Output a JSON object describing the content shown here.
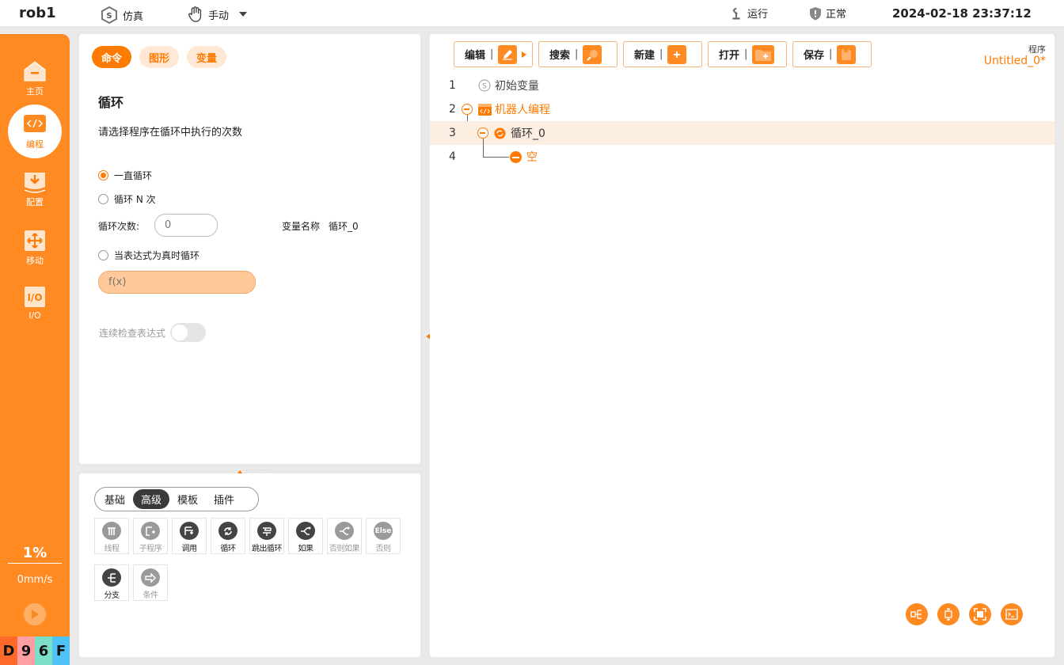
{
  "topbar": {
    "robot_name": "rob1",
    "sim_label": "仿真",
    "mode_label": "手动",
    "run_label": "运行",
    "status_label": "正常",
    "datetime": "2024-02-18 23:37:12"
  },
  "sidebar": {
    "items": [
      {
        "label": "主页",
        "icon": "home-icon"
      },
      {
        "label": "编程",
        "icon": "code-icon",
        "active": true
      },
      {
        "label": "配置",
        "icon": "download-icon"
      },
      {
        "label": "移动",
        "icon": "move-icon"
      },
      {
        "label": "I/O",
        "icon": "io-icon"
      }
    ],
    "speed_percent": "1%",
    "speed_value": "0mm/s",
    "code_chars": [
      "D",
      "9",
      "6",
      "F"
    ],
    "code_colors": [
      "#ff6a2a",
      "#ff9ea3",
      "#7ce0c8",
      "#4fc3f7"
    ]
  },
  "command_panel": {
    "tabs": [
      "命令",
      "图形",
      "变量"
    ],
    "active_tab": "命令",
    "title": "循环",
    "description": "请选择程序在循环中执行的次数",
    "option_forever": "一直循环",
    "option_n_times": "循环 N 次",
    "count_label": "循环次数:",
    "count_placeholder": "0",
    "var_name_label": "变量名称",
    "var_name_value": "循环_0",
    "option_expression": "当表达式为真时循环",
    "expression_placeholder": "f(x)",
    "continuous_check_label": "连续检查表达式",
    "selected_option": "一直循环"
  },
  "library_panel": {
    "tabs": [
      "基础",
      "高级",
      "模板",
      "插件"
    ],
    "active_tab": "高级",
    "commands": [
      {
        "label": "线程",
        "enabled": false,
        "icon": "thread-icon"
      },
      {
        "label": "子程序",
        "enabled": false,
        "icon": "subprogram-icon"
      },
      {
        "label": "调用",
        "enabled": true,
        "icon": "call-icon"
      },
      {
        "label": "循环",
        "enabled": true,
        "icon": "loop-icon"
      },
      {
        "label": "跳出循环",
        "enabled": true,
        "icon": "break-icon"
      },
      {
        "label": "如果",
        "enabled": true,
        "icon": "if-icon"
      },
      {
        "label": "否则如果",
        "enabled": false,
        "icon": "elseif-icon"
      },
      {
        "label": "否则",
        "enabled": false,
        "icon": "else-icon",
        "icon_text": "Else"
      },
      {
        "label": "分支",
        "enabled": true,
        "icon": "switch-icon"
      },
      {
        "label": "条件",
        "enabled": false,
        "icon": "condition-icon"
      }
    ]
  },
  "program_panel": {
    "toolbar": {
      "edit": "编辑",
      "search": "搜索",
      "new": "新建",
      "open": "打开",
      "save": "保存"
    },
    "program_label": "程序",
    "program_name": "Untitled_0*",
    "tree": [
      {
        "line": "1",
        "label": "初始变量"
      },
      {
        "line": "2",
        "label": "机器人编程"
      },
      {
        "line": "3",
        "label": "循环_0"
      },
      {
        "line": "4",
        "label": "空"
      }
    ],
    "selected_line": "3"
  },
  "colors": {
    "accent": "#ff7a00",
    "sidebar": "#ff8a22",
    "selected_row": "#fdeee2"
  }
}
